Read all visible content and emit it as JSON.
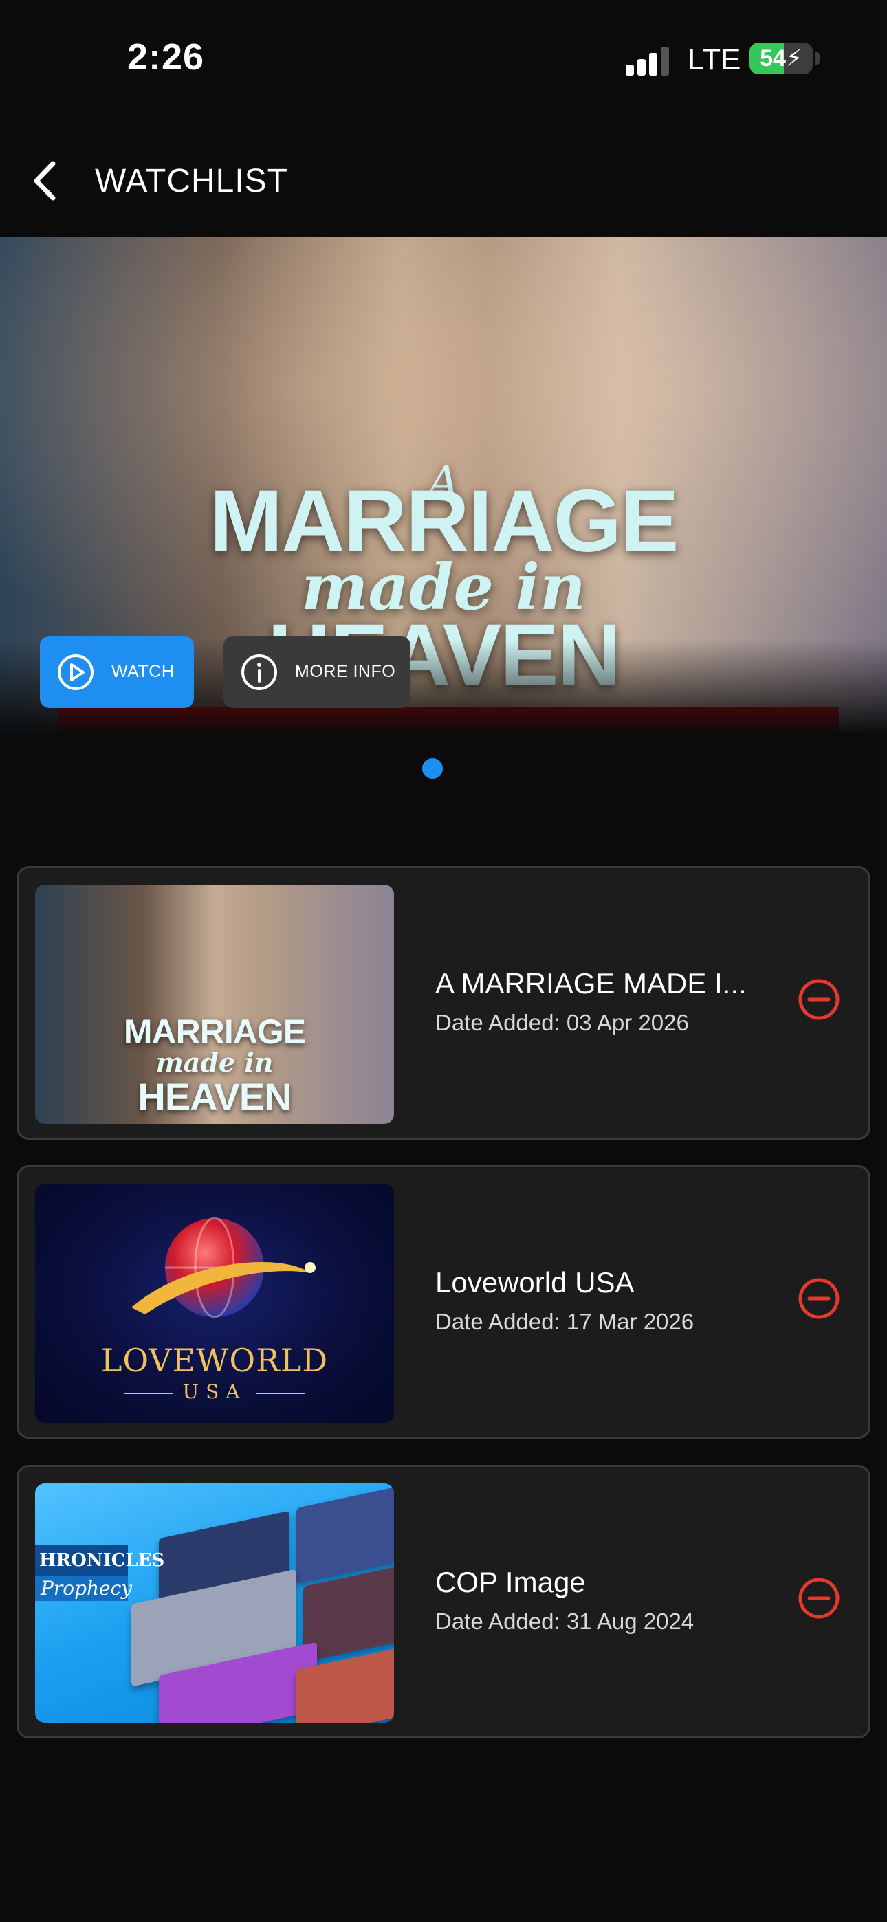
{
  "status_bar": {
    "time": "2:26",
    "network": "LTE",
    "battery": "54",
    "battery_level": 0.54,
    "battery_color": "#34c759"
  },
  "header": {
    "back_icon": "chevron-left-icon",
    "title": "WATCHLIST"
  },
  "hero": {
    "poster_title_a": "A",
    "poster_title_main": "MARRIAGE",
    "poster_title_sub": "made in",
    "poster_title_heaven": "HEAVEN",
    "watch_button": {
      "icon": "play-circle-icon",
      "label": "WATCH",
      "color": "#1f8ef1"
    },
    "info_button": {
      "icon": "info-circle-icon",
      "label": "MORE INFO"
    },
    "pager": {
      "active": 1,
      "total": 1
    }
  },
  "watchlist": [
    {
      "title": "A MARRIAGE MADE I...",
      "date_added": "Date Added: 03 Apr 2026",
      "thumb_text": [
        "MARRIAGE",
        "made in",
        "HEAVEN"
      ],
      "remove_icon": "minus-circle-icon"
    },
    {
      "title": "Loveworld USA",
      "date_added": "Date Added: 17 Mar 2026",
      "thumb_text": [
        "LOVEWORLD",
        "USA"
      ],
      "remove_icon": "minus-circle-icon"
    },
    {
      "title": "COP Image",
      "date_added": "Date Added: 31 Aug 2024",
      "thumb_text": [
        "HRONICLES",
        "Prophecy"
      ],
      "remove_icon": "minus-circle-icon"
    }
  ],
  "colors": {
    "background": "#0b0b0b",
    "card": "#1c1c1c",
    "accent": "#1f8ef1",
    "remove": "#e5392b"
  }
}
